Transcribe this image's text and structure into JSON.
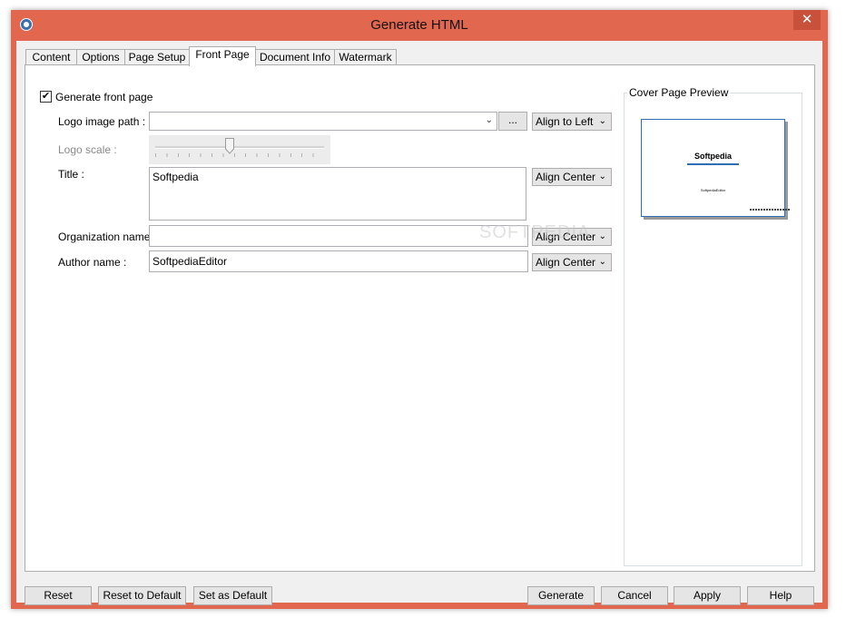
{
  "window": {
    "title": "Generate HTML",
    "close_label": "✕"
  },
  "tabs": [
    {
      "label": "Content"
    },
    {
      "label": "Options"
    },
    {
      "label": "Page Setup"
    },
    {
      "label": "Front Page",
      "active": true
    },
    {
      "label": "Document Info"
    },
    {
      "label": "Watermark"
    }
  ],
  "front_page": {
    "generate_checkbox": {
      "label": "Generate front page",
      "checked": true
    },
    "logo_path": {
      "label": "Logo image path :",
      "value": "",
      "browse_label": "...",
      "align": "Align to Left"
    },
    "logo_scale": {
      "label": "Logo scale :"
    },
    "title": {
      "label": "Title :",
      "value": "Softpedia",
      "align": "Align Center"
    },
    "organization": {
      "label": "Organization name :",
      "value": "",
      "align": "Align Center"
    },
    "author": {
      "label": "Author name :",
      "value": "SoftpediaEditor",
      "align": "Align Center"
    }
  },
  "preview": {
    "group_title": "Cover Page Preview",
    "page_title": "Softpedia",
    "page_author": "SoftpediaEditor"
  },
  "watermark": {
    "text": "SOFTPEDIA"
  },
  "buttons": {
    "reset": "Reset",
    "reset_default": "Reset to Default",
    "set_default": "Set as Default",
    "generate": "Generate",
    "cancel": "Cancel",
    "apply": "Apply",
    "help": "Help"
  },
  "colors": {
    "title_bar": "#e2674f",
    "preview_border": "#2e6fb3"
  }
}
